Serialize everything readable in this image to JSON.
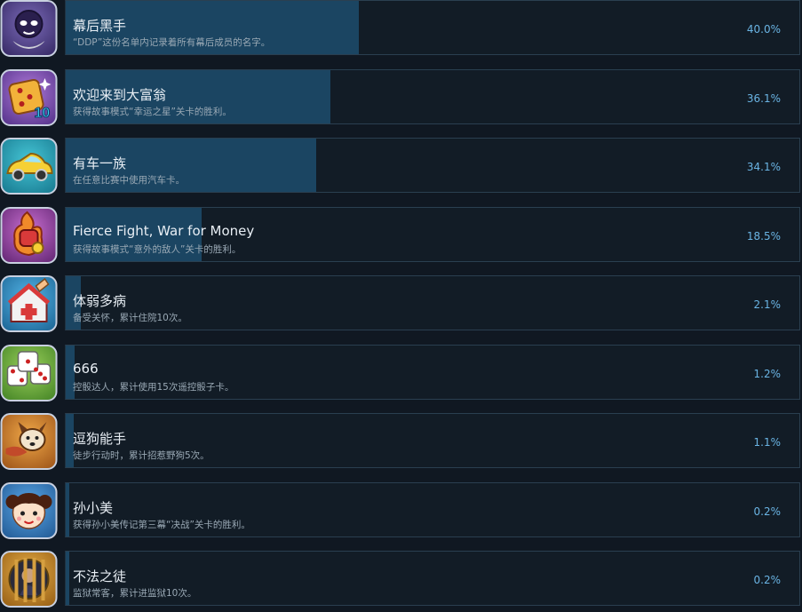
{
  "achievements": [
    {
      "name": "幕后黑手",
      "description": "“DDP”这份名单内记录着所有幕后成员的名字。",
      "percent_label": "40.0%",
      "percent": 40.0,
      "icon": "purple-ghost-icon",
      "icon_colors": [
        "#7b6bb8",
        "#3a2d6a"
      ]
    },
    {
      "name": "欢迎来到大富翁",
      "description": "获得故事模式“幸运之星”关卡的胜利。",
      "percent_label": "36.1%",
      "percent": 36.1,
      "icon": "dice-ten-icon",
      "icon_colors": [
        "#b07ad8",
        "#5a3790"
      ]
    },
    {
      "name": "有车一族",
      "description": "在任意比赛中使用汽车卡。",
      "percent_label": "34.1%",
      "percent": 34.1,
      "icon": "yellow-car-icon",
      "icon_colors": [
        "#46c6d6",
        "#1b7f95"
      ]
    },
    {
      "name": "Fierce Fight, War for Money",
      "description": "获得故事模式“意外的敌人”关卡的胜利。",
      "percent_label": "18.5%",
      "percent": 18.5,
      "icon": "flaming-fist-icon",
      "icon_colors": [
        "#c86fd0",
        "#6a2b7a"
      ]
    },
    {
      "name": "体弱多病",
      "description": "备受关怀，累计住院10次。",
      "percent_label": "2.1%",
      "percent": 2.1,
      "icon": "hospital-icon",
      "icon_colors": [
        "#54b6e8",
        "#206a9a"
      ]
    },
    {
      "name": "666",
      "description": "控骰达人，累计使用15次遥控骰子卡。",
      "percent_label": "1.2%",
      "percent": 1.2,
      "icon": "three-dice-icon",
      "icon_colors": [
        "#9ad05a",
        "#4b8a2a"
      ]
    },
    {
      "name": "逗狗能手",
      "description": "徒步行动时，累计招惹野狗5次。",
      "percent_label": "1.1%",
      "percent": 1.1,
      "icon": "dog-icon",
      "icon_colors": [
        "#f0a848",
        "#a35a1c"
      ]
    },
    {
      "name": "孙小美",
      "description": "获得孙小美传记第三幕“决战”关卡的胜利。",
      "percent_label": "0.2%",
      "percent": 0.2,
      "icon": "girl-face-icon",
      "icon_colors": [
        "#5aa8e8",
        "#265f9a"
      ]
    },
    {
      "name": "不法之徒",
      "description": "监狱常客，累计进监狱10次。",
      "percent_label": "0.2%",
      "percent": 0.2,
      "icon": "prisoner-icon",
      "icon_colors": [
        "#e8b04a",
        "#9c6418"
      ]
    }
  ]
}
